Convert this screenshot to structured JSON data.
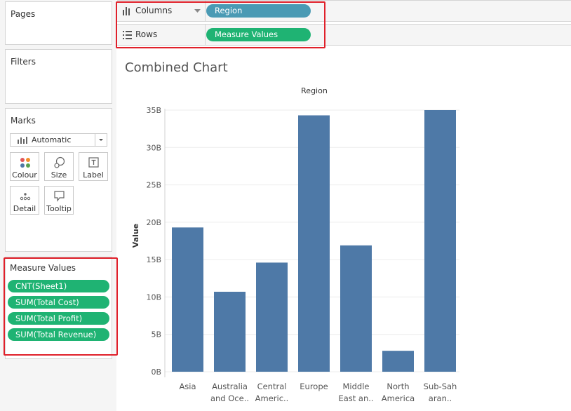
{
  "left_panel": {
    "pages_title": "Pages",
    "filters_title": "Filters",
    "marks": {
      "title": "Marks",
      "dropdown_icon": "bar-chart-icon",
      "dropdown_value": "Automatic",
      "buttons": [
        {
          "label": "Colour",
          "icon": "colour-icon"
        },
        {
          "label": "Size",
          "icon": "size-icon"
        },
        {
          "label": "Label",
          "icon": "label-icon"
        },
        {
          "label": "Detail",
          "icon": "detail-icon"
        },
        {
          "label": "Tooltip",
          "icon": "tooltip-icon"
        }
      ]
    },
    "measure_values": {
      "title": "Measure Values",
      "pills": [
        "CNT(Sheet1)",
        "SUM(Total Cost)",
        "SUM(Total Profit)",
        "SUM(Total Revenue)"
      ],
      "pill_color": "#1fb373"
    }
  },
  "shelves": {
    "columns": {
      "label": "Columns",
      "pill": "Region",
      "pill_color": "#4a9ab4"
    },
    "rows": {
      "label": "Rows",
      "pill": "Measure Values",
      "pill_color": "#1fb373"
    }
  },
  "highlight_color": "#e0202a",
  "chart_data": {
    "type": "bar",
    "title": "Combined Chart",
    "header": "Region",
    "ylabel": "Value",
    "categories": [
      [
        "Asia"
      ],
      [
        "Australia",
        "and Oce.."
      ],
      [
        "Central",
        "Americ.."
      ],
      [
        "Europe"
      ],
      [
        "Middle",
        "East an.."
      ],
      [
        "North",
        "America"
      ],
      [
        "Sub-Sah",
        "aran.."
      ]
    ],
    "values": [
      19.3,
      10.7,
      14.6,
      34.3,
      16.9,
      2.8,
      35.0
    ],
    "unit": "B",
    "ylim": [
      0,
      35
    ],
    "yticks": [
      "0B",
      "5B",
      "10B",
      "15B",
      "20B",
      "25B",
      "30B",
      "35B"
    ],
    "bar_color": "#4e79a7",
    "grid": true
  }
}
